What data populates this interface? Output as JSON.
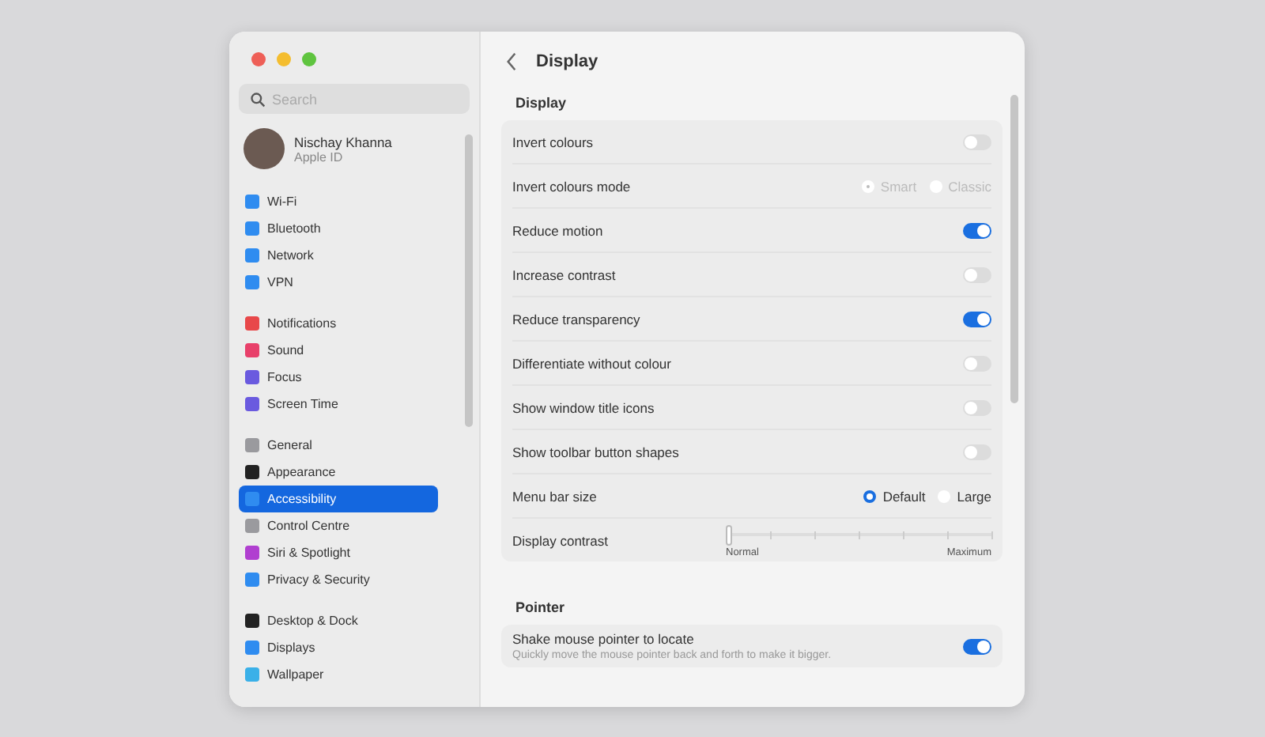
{
  "window": {
    "title": "Display"
  },
  "sidebar": {
    "search": {
      "placeholder": "Search"
    },
    "profile": {
      "name": "Nischay Khanna",
      "subtitle": "Apple ID"
    },
    "groups": [
      {
        "items": [
          {
            "label": "Wi-Fi",
            "color": "#2f8cf0",
            "selected": false
          },
          {
            "label": "Bluetooth",
            "color": "#2f8cf0",
            "selected": false
          },
          {
            "label": "Network",
            "color": "#2f8cf0",
            "selected": false
          },
          {
            "label": "VPN",
            "color": "#2f8cf0",
            "selected": false
          }
        ]
      },
      {
        "items": [
          {
            "label": "Notifications",
            "color": "#e8484a",
            "selected": false
          },
          {
            "label": "Sound",
            "color": "#e8406a",
            "selected": false
          },
          {
            "label": "Focus",
            "color": "#6a5adf",
            "selected": false
          },
          {
            "label": "Screen Time",
            "color": "#6a5adf",
            "selected": false
          }
        ]
      },
      {
        "items": [
          {
            "label": "General",
            "color": "#9a9a9e",
            "selected": false
          },
          {
            "label": "Appearance",
            "color": "#222222",
            "selected": false
          },
          {
            "label": "Accessibility",
            "color": "#2f8cf0",
            "selected": true
          },
          {
            "label": "Control Centre",
            "color": "#9a9a9e",
            "selected": false
          },
          {
            "label": "Siri & Spotlight",
            "color": "#b03fd0",
            "selected": false
          },
          {
            "label": "Privacy & Security",
            "color": "#2f8cf0",
            "selected": false
          }
        ]
      },
      {
        "items": [
          {
            "label": "Desktop & Dock",
            "color": "#222222",
            "selected": false
          },
          {
            "label": "Displays",
            "color": "#2f8cf0",
            "selected": false
          },
          {
            "label": "Wallpaper",
            "color": "#3ab0e8",
            "selected": false
          }
        ]
      }
    ]
  },
  "sections": [
    {
      "title": "Display",
      "rows": [
        {
          "kind": "toggle",
          "label": "Invert colours",
          "on": false
        },
        {
          "kind": "radio",
          "label": "Invert colours mode",
          "disabled": true,
          "options": [
            {
              "label": "Smart",
              "selected": true
            },
            {
              "label": "Classic",
              "selected": false
            }
          ]
        },
        {
          "kind": "toggle",
          "label": "Reduce motion",
          "on": true
        },
        {
          "kind": "toggle",
          "label": "Increase contrast",
          "on": false
        },
        {
          "kind": "toggle",
          "label": "Reduce transparency",
          "on": true
        },
        {
          "kind": "toggle",
          "label": "Differentiate without colour",
          "on": false
        },
        {
          "kind": "toggle",
          "label": "Show window title icons",
          "on": false
        },
        {
          "kind": "toggle",
          "label": "Show toolbar button shapes",
          "on": false
        },
        {
          "kind": "radio",
          "label": "Menu bar size",
          "disabled": false,
          "options": [
            {
              "label": "Default",
              "selected": true
            },
            {
              "label": "Large",
              "selected": false
            }
          ]
        },
        {
          "kind": "slider",
          "label": "Display contrast",
          "level": 0,
          "min_label": "Normal",
          "max_label": "Maximum"
        }
      ]
    },
    {
      "title": "Pointer",
      "rows": [
        {
          "kind": "toggle",
          "label": "Shake mouse pointer to locate",
          "subtitle": "Quickly move the mouse pointer back and forth to make it bigger.",
          "on": true
        }
      ]
    }
  ]
}
